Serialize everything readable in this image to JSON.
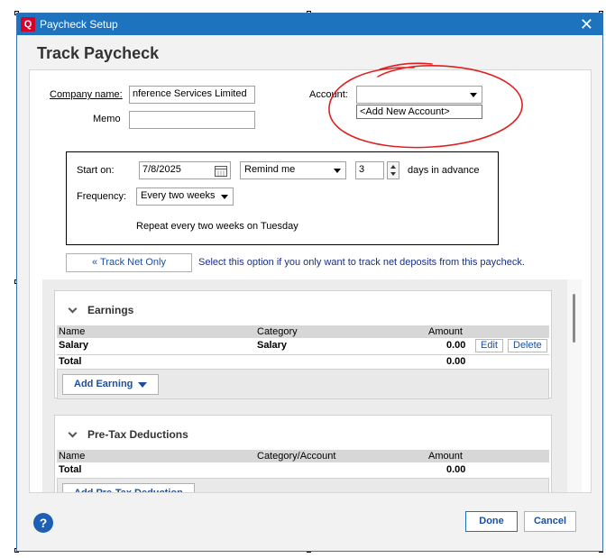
{
  "window": {
    "title": "Paycheck Setup",
    "app_icon_letter": "Q",
    "close_glyph": "✕"
  },
  "heading": "Track Paycheck",
  "company": {
    "label": "Company name:",
    "value": "nference Services Limited"
  },
  "memo": {
    "label": "Memo",
    "value": ""
  },
  "account": {
    "label": "Account:",
    "value": "",
    "dropdown_option": "<Add New Account>"
  },
  "schedule": {
    "start_label": "Start on:",
    "start_value": "7/8/2025",
    "remind_value": "Remind me",
    "days_value": "3",
    "days_suffix": "days in advance",
    "frequency_label": "Frequency:",
    "frequency_value": "Every two weeks",
    "repeat_text": "Repeat every two weeks on Tuesday"
  },
  "track_net": {
    "button": "« Track Net Only",
    "hint": "Select this option if you only want to track net deposits from this paycheck."
  },
  "earnings": {
    "title": "Earnings",
    "columns": [
      "Name",
      "Category",
      "Amount"
    ],
    "rows": [
      {
        "name": "Salary",
        "category": "Salary",
        "amount": "0.00",
        "edit": "Edit",
        "delete": "Delete"
      }
    ],
    "total_label": "Total",
    "total_amount": "0.00",
    "add_button": "Add Earning"
  },
  "pretax": {
    "title": "Pre-Tax Deductions",
    "columns": [
      "Name",
      "Category/Account",
      "Amount"
    ],
    "total_label": "Total",
    "total_amount": "0.00",
    "add_button": "Add Pre-Tax Deduction"
  },
  "footer": {
    "help_glyph": "?",
    "done": "Done",
    "cancel": "Cancel"
  },
  "colors": {
    "title_bar": "#1e73be",
    "link_blue": "#1a4fa0",
    "annotation_red": "#e02020",
    "app_icon_red": "#d6002b"
  }
}
